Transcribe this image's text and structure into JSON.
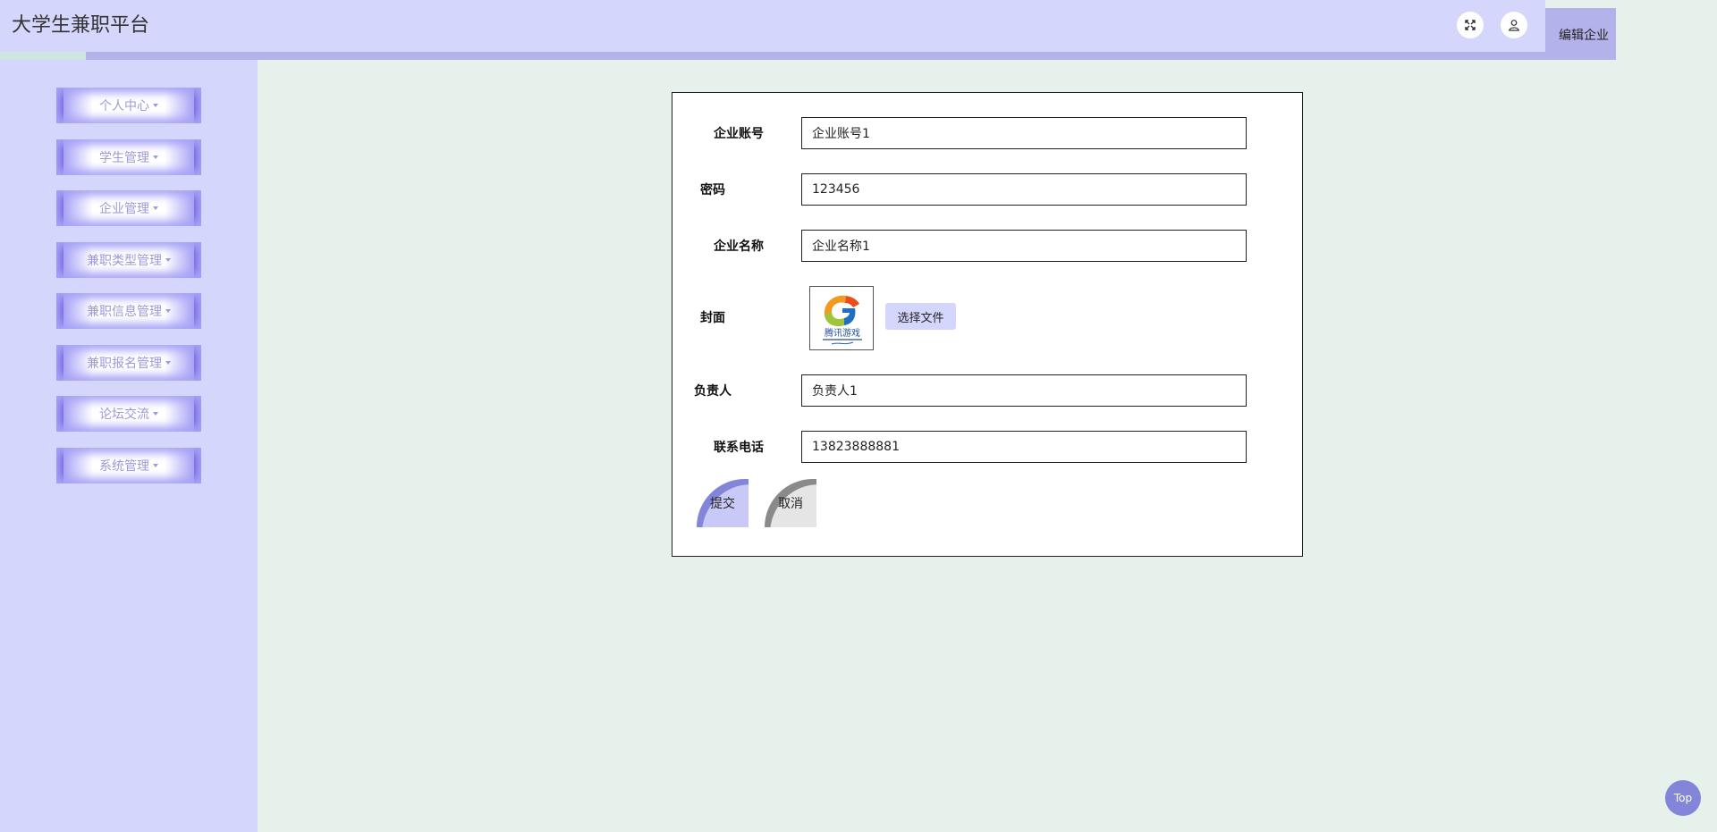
{
  "app": {
    "title": "大学生兼职平台",
    "breadcrumb": "编辑企业"
  },
  "header": {
    "fullscreen_icon": "fullscreen-icon",
    "user_icon": "user-icon"
  },
  "sidebar": {
    "items": [
      {
        "label": "个人中心"
      },
      {
        "label": "学生管理"
      },
      {
        "label": "企业管理"
      },
      {
        "label": "兼职类型管理"
      },
      {
        "label": "兼职信息管理"
      },
      {
        "label": "兼职报名管理"
      },
      {
        "label": "论坛交流"
      },
      {
        "label": "系统管理"
      }
    ]
  },
  "form": {
    "account": {
      "label": "企业账号",
      "value": "企业账号1"
    },
    "password": {
      "label": "密码",
      "value": "123456"
    },
    "company_name": {
      "label": "企业名称",
      "value": "企业名称1"
    },
    "cover": {
      "label": "封面",
      "choose_file_label": "选择文件",
      "logo_text": "腾讯游戏"
    },
    "manager": {
      "label": "负责人",
      "value": "负责人1"
    },
    "phone": {
      "label": "联系电话",
      "value": "13823888881"
    },
    "submit_label": "提交",
    "cancel_label": "取消"
  },
  "top_button": {
    "label": "Top"
  },
  "colors": {
    "header_bg": "#d5d6fc",
    "sidebar_bg": "#d5d6fc",
    "page_bg": "#e7f1ec",
    "accent": "#6a55dd",
    "button_accent": "#8386d8"
  }
}
